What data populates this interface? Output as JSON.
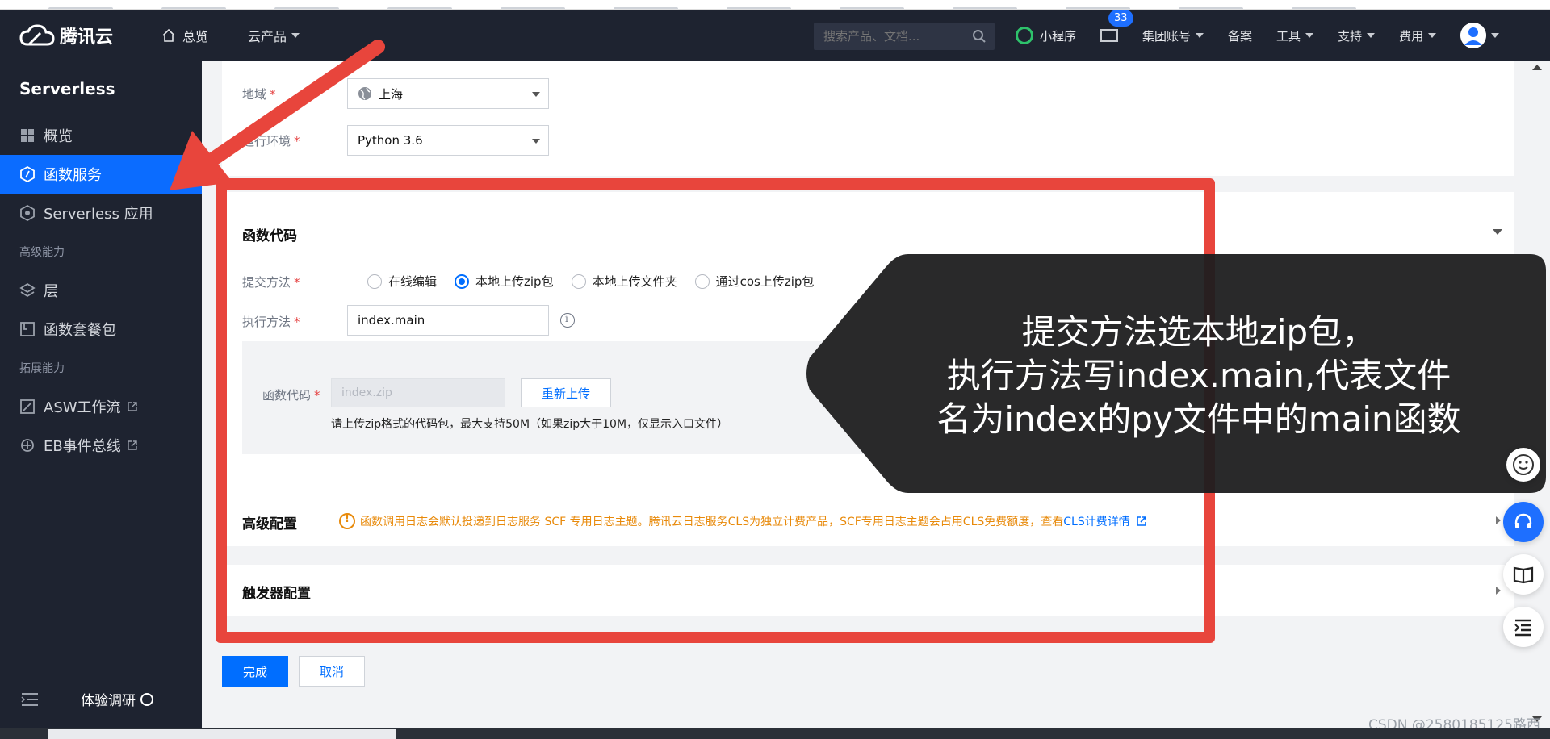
{
  "topbar": {
    "brand": "腾讯云",
    "home": "总览",
    "products": "云产品",
    "search_placeholder": "搜索产品、文档...",
    "mini_program": "小程序",
    "mail_badge": "33",
    "group_account": "集团账号",
    "beian": "备案",
    "tools": "工具",
    "support": "支持",
    "billing": "费用"
  },
  "sidebar": {
    "title": "Serverless",
    "items": [
      {
        "label": "概览",
        "icon": "grid-icon"
      },
      {
        "label": "函数服务",
        "icon": "function-icon",
        "active": true
      },
      {
        "label": "Serverless 应用",
        "icon": "app-icon"
      }
    ],
    "section_advanced": "高级能力",
    "advanced": [
      {
        "label": "层",
        "icon": "layers-icon"
      },
      {
        "label": "函数套餐包",
        "icon": "package-icon"
      }
    ],
    "section_extend": "拓展能力",
    "extend": [
      {
        "label": "ASW工作流",
        "icon": "workflow-icon"
      },
      {
        "label": "EB事件总线",
        "icon": "eventbus-icon"
      }
    ],
    "footer_survey": "体验调研"
  },
  "form": {
    "region_label": "地域",
    "region_value": "上海",
    "runtime_label": "运行环境",
    "runtime_value": "Python 3.6",
    "code_section": "函数代码",
    "submit_label": "提交方法",
    "submit_options": [
      "在线编辑",
      "本地上传zip包",
      "本地上传文件夹",
      "通过cos上传zip包"
    ],
    "submit_selected_index": 1,
    "handler_label": "执行方法",
    "handler_value": "index.main",
    "code_label": "函数代码",
    "code_placeholder": "index.zip",
    "reupload_button": "重新上传",
    "upload_hint": "请上传zip格式的代码包，最大支持50M（如果zip大于10M，仅显示入口文件）",
    "advanced_section": "高级配置",
    "advanced_warning": "函数调用日志会默认投递到日志服务 SCF 专用日志主题。腾讯云日志服务CLS为独立计费产品，SCF专用日志主题会占用CLS免费额度，查看",
    "advanced_link": "CLS计费详情",
    "trigger_section": "触发器配置",
    "done_button": "完成",
    "cancel_button": "取消"
  },
  "annotation": {
    "lines": [
      "提交方法选本地zip包，",
      "执行方法写index.main,代表文件",
      "名为index的py文件中的main函数"
    ]
  },
  "watermark": "CSDN @2580185125路西",
  "colors": {
    "accent": "#006eff",
    "sidebar_bg": "#1e2330",
    "highlight": "#e8453c",
    "warning": "#e88a0b"
  }
}
